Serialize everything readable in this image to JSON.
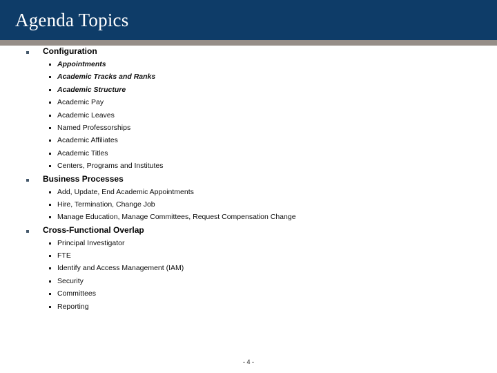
{
  "slide": {
    "title": "Agenda Topics",
    "page_number": "- 4 -",
    "colors": {
      "banner": "#0e3c68",
      "rule": "#968e88",
      "title_text": "#ffffff",
      "bullet_level1": "#44586b",
      "bullet_level2": "#1a1a1a",
      "body_text": "#0d0d0d",
      "background": "#ffffff"
    }
  },
  "topics": [
    {
      "label": "Configuration",
      "items": [
        {
          "text": "Appointments",
          "emphasis": true
        },
        {
          "text": "Academic Tracks and Ranks",
          "emphasis": true
        },
        {
          "text": "Academic Structure",
          "emphasis": true
        },
        {
          "text": "Academic Pay",
          "emphasis": false
        },
        {
          "text": "Academic Leaves",
          "emphasis": false
        },
        {
          "text": "Named Professorships",
          "emphasis": false
        },
        {
          "text": "Academic Affiliates",
          "emphasis": false
        },
        {
          "text": "Academic Titles",
          "emphasis": false
        },
        {
          "text": "Centers, Programs and Institutes",
          "emphasis": false
        }
      ]
    },
    {
      "label": "Business Processes",
      "items": [
        {
          "text": "Add, Update, End Academic Appointments",
          "emphasis": false
        },
        {
          "text": "Hire, Termination, Change Job",
          "emphasis": false
        },
        {
          "text": "Manage Education, Manage Committees, Request Compensation Change",
          "emphasis": false
        }
      ]
    },
    {
      "label": "Cross-Functional Overlap",
      "items": [
        {
          "text": "Principal Investigator",
          "emphasis": false
        },
        {
          "text": "FTE",
          "emphasis": false
        },
        {
          "text": "Identify and Access Management (IAM)",
          "emphasis": false
        },
        {
          "text": "Security",
          "emphasis": false
        },
        {
          "text": "Committees",
          "emphasis": false
        },
        {
          "text": "Reporting",
          "emphasis": false
        }
      ]
    }
  ]
}
